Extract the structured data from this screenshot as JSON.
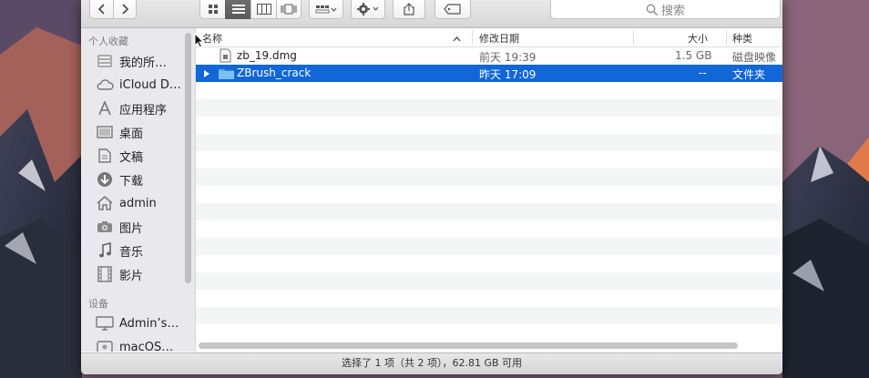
{
  "toolbar": {
    "back_icon": "chevron-left-icon",
    "forward_icon": "chevron-right-icon",
    "search_placeholder": "搜索"
  },
  "sidebar": {
    "favorites_header": "个人收藏",
    "devices_header": "设备",
    "favorites": [
      {
        "label": "我的所…",
        "icon": "all-files-icon"
      },
      {
        "label": "iCloud D…",
        "icon": "cloud-icon"
      },
      {
        "label": "应用程序",
        "icon": "applications-icon"
      },
      {
        "label": "桌面",
        "icon": "desktop-icon"
      },
      {
        "label": "文稿",
        "icon": "documents-icon"
      },
      {
        "label": "下载",
        "icon": "download-icon"
      },
      {
        "label": "admin",
        "icon": "home-icon"
      },
      {
        "label": "图片",
        "icon": "camera-icon"
      },
      {
        "label": "音乐",
        "icon": "music-icon"
      },
      {
        "label": "影片",
        "icon": "film-icon"
      }
    ],
    "devices": [
      {
        "label": "Admin’s…",
        "icon": "computer-icon"
      },
      {
        "label": "macOS…",
        "icon": "disk-icon"
      }
    ]
  },
  "columns": {
    "name": "名称",
    "modified": "修改日期",
    "size": "大小",
    "kind": "种类"
  },
  "files": [
    {
      "name": "zb_19.dmg",
      "modified": "前天 19:39",
      "size": "1.5 GB",
      "kind": "磁盘映像",
      "selected": false
    },
    {
      "name": "ZBrush_crack",
      "modified": "昨天 17:09",
      "size": "--",
      "kind": "文件夹",
      "selected": true
    }
  ],
  "status": {
    "text": "选择了 1 项（共 2 项），62.81 GB 可用"
  },
  "colors": {
    "selection": "#1166d8",
    "folder": "#5aa9e6"
  }
}
